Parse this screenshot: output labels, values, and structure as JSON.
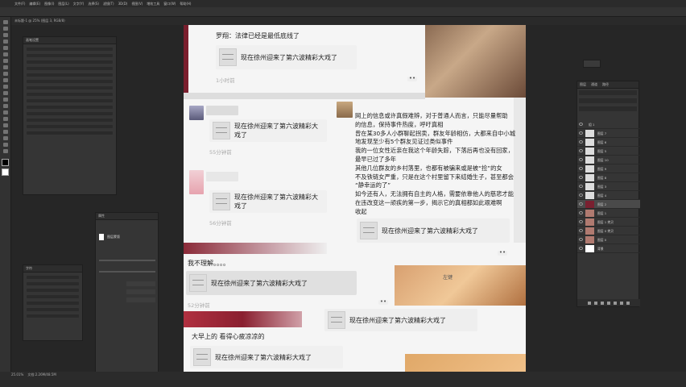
{
  "menu": [
    "文件(F)",
    "编辑(E)",
    "图像(I)",
    "图层(L)",
    "文字(Y)",
    "选择(S)",
    "滤镜(T)",
    "3D(D)",
    "视图(V)",
    "增效工具",
    "窗口(W)",
    "帮助(H)"
  ],
  "tab": {
    "title": "未标题-1 @ 25% (图层 3, RGB/8)"
  },
  "canvas": {
    "top_comment": "罗翔：法律已经是最低底线了",
    "link_text": "现在徐州迎来了第六波精彩大戏了",
    "times": [
      "1小时前",
      "55分钟前",
      "56分钟前",
      "52分钟前"
    ],
    "more": "••",
    "reply_1": "我不理解。。。。",
    "reply_2": "大早上的 看得心疲凉凉的",
    "label_left": "左键",
    "long_text_lines": [
      "网上的信息或许真假难辨，对于普通人而言，只能尽量帮助",
      "的信息，保持事件热度，呼吁真相",
      "曾在某30多人小群聊起拐卖，群友年龄相仿，大都来自中小城",
      "地发现至少有5个群友见证过类似事件",
      "我的一位女性近亲在我这个年龄失踪，下落后再也没有回家，",
      "最早已过了多年",
      "其他几位群友的乡村落里，也都有被骗来或是被“捡”的女",
      "不及铁链女严重，只是在这个村里留下来结婚生子，甚至都会",
      "“静幸运的了”",
      "如今还有人，无法拥有自主的人格，需要依靠他人的慈悲才能",
      "在违改变这一顽疾的第一步，揭示它的真相都如此艰难啊",
      "收起"
    ]
  },
  "layers_panel": {
    "tabs": [
      "图层",
      "通道",
      "路径"
    ],
    "rows": [
      "组 1",
      "图层 7",
      "图层 6",
      "图层 5",
      "图层 10",
      "图层 9",
      "图层 8",
      "图层 3",
      "图层 4",
      "图层 2",
      "图层 1",
      "图层 1 拷贝",
      "图层 0 拷贝",
      "图层 0",
      "背景"
    ]
  },
  "props_panel": {
    "title": "属性",
    "label": "图层蒙版"
  },
  "char_panel": {
    "title": "字符"
  },
  "left_panel": {
    "title": "画笔设置"
  },
  "status": {
    "zoom": "25.01%",
    "info": "文档:2.26M/48.5M"
  }
}
